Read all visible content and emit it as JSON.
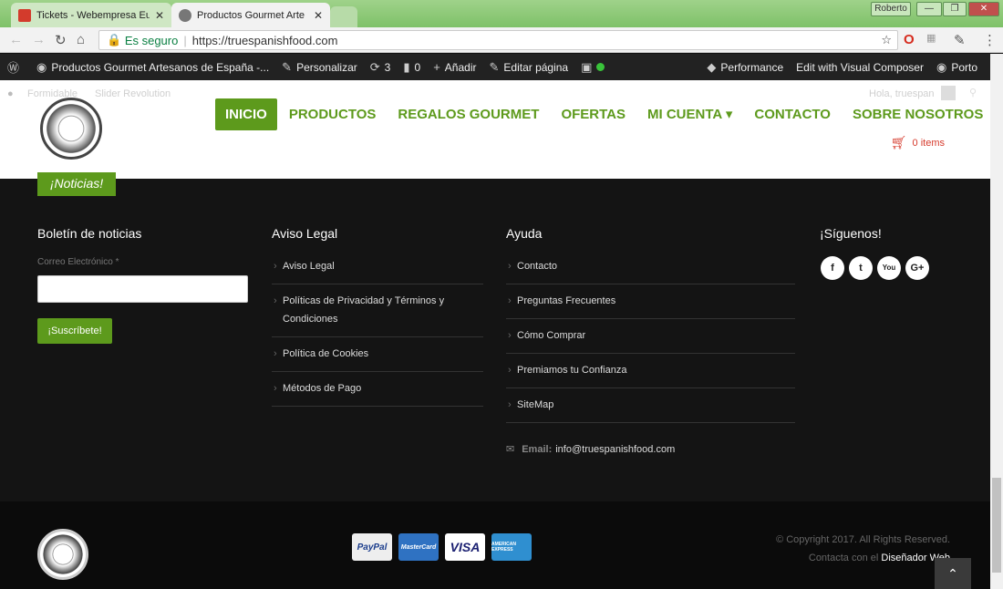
{
  "browser": {
    "tabs": [
      {
        "label": "Tickets - Webempresa Eu",
        "favicon_color": "#d33b2c"
      },
      {
        "label": "Productos Gourmet Arte",
        "favicon_color": "#777777"
      }
    ],
    "window_user": "Roberto",
    "address": {
      "secure_label": "Es seguro",
      "url": "https://truespanishfood.com"
    }
  },
  "adminbar": {
    "items": [
      {
        "icon": "wordpress-icon",
        "label": ""
      },
      {
        "icon": "dashboard-icon",
        "label": "Productos Gourmet Artesanos de España -..."
      },
      {
        "icon": "brush-icon",
        "label": "Personalizar"
      },
      {
        "icon": "refresh-icon",
        "label": "3"
      },
      {
        "icon": "comment-icon",
        "label": "0"
      },
      {
        "icon": "plus-icon",
        "label": "Añadir"
      },
      {
        "icon": "pencil-icon",
        "label": "Editar página"
      }
    ],
    "right_items": [
      "Performance",
      "Edit with Visual Composer",
      "Porto"
    ]
  },
  "subbar": {
    "left": [
      "Formidable",
      "Slider Revolution"
    ],
    "greeting": "Hola, truespan"
  },
  "nav": {
    "items": [
      "INICIO",
      "PRODUCTOS",
      "REGALOS GOURMET",
      "OFERTAS",
      "MI CUENTA ▾",
      "CONTACTO",
      "SOBRE NOSOTROS"
    ],
    "active": "INICIO",
    "cart": "0 items"
  },
  "footer": {
    "news_tab": "¡Noticias!",
    "newsletter": {
      "title": "Boletín de noticias",
      "field_label": "Correo Electrónico *",
      "button": "¡Suscríbete!"
    },
    "legal": {
      "title": "Aviso Legal",
      "links": [
        "Aviso Legal",
        "Políticas de Privacidad y Términos y Condiciones",
        "Política de Cookies",
        "Métodos de Pago"
      ]
    },
    "help": {
      "title": "Ayuda",
      "links": [
        "Contacto",
        "Preguntas Frecuentes",
        "Cómo Comprar",
        "Premiamos tu Confianza",
        "SiteMap"
      ]
    },
    "social": {
      "title": "¡Síguenos!",
      "icons": [
        "f",
        "t",
        "You",
        "G+"
      ]
    },
    "contact": {
      "label": "Email:",
      "email": "info@truespanishfood.com"
    }
  },
  "bottom": {
    "payments": [
      "PayPal",
      "MasterCard",
      "VISA",
      "AMERICAN EXPRESS"
    ],
    "copyright": "© Copyright 2017. All Rights Reserved.",
    "designer_prefix": "Contacta con el",
    "designer_link": "Diseñador Web"
  },
  "colors": {
    "brand_green": "#5d9a1c",
    "footer_bg": "#141414"
  }
}
